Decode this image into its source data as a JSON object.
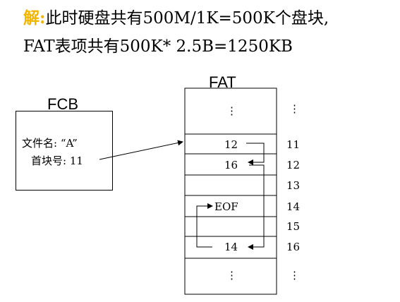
{
  "problem": {
    "solution_label": "解:",
    "line1_text": "此时硬盘共有500M/1K=500K个盘块,",
    "line2_text": "FAT表项共有500K* 2.5B=1250KB"
  },
  "diagram": {
    "fat_label": "FAT",
    "fcb_label": "FCB",
    "fcb_filename": "文件名: “A”",
    "fcb_first_block": "首块号: 11",
    "rows": [
      {
        "value": "⋮",
        "index": "⋮"
      },
      {
        "value": "12",
        "index": "11"
      },
      {
        "value": "16",
        "index": "12"
      },
      {
        "value": "",
        "index": "13"
      },
      {
        "value": "EOF",
        "index": "14"
      },
      {
        "value": "",
        "index": "15"
      },
      {
        "value": "14",
        "index": "16"
      },
      {
        "value": "⋮",
        "index": "⋮"
      }
    ]
  }
}
